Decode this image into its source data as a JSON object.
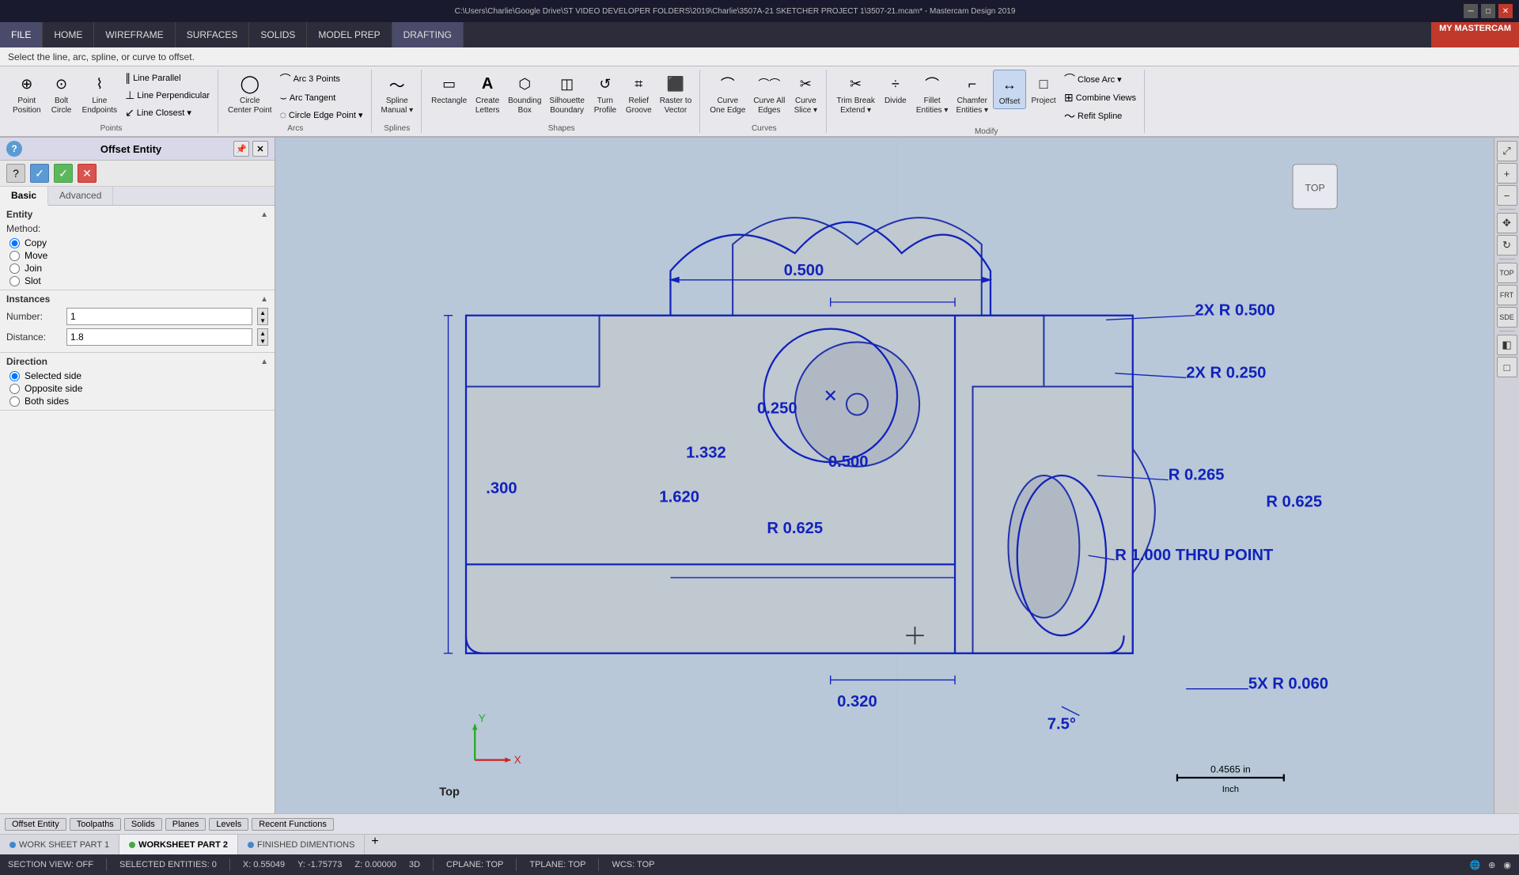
{
  "titlebar": {
    "title": "C:\\Users\\Charlie\\Google Drive\\ST VIDEO DEVELOPER FOLDERS\\2019\\Charlie\\3507A-21 SKETCHER PROJECT 1\\3507-21.mcam* - Mastercam Design 2019",
    "min": "─",
    "max": "□",
    "close": "✕"
  },
  "menu": {
    "items": [
      "FILE",
      "HOME",
      "WIREFRAME",
      "SURFACES",
      "SOLIDS",
      "MODEL PREP",
      "DRAFTING"
    ]
  },
  "prompt": {
    "text": "Select the line, arc, spline, or curve to offset.",
    "my_mastercam": "MY MASTERCAM"
  },
  "ribbon": {
    "points_group": {
      "label": "Points",
      "buttons": [
        {
          "icon": "⊕",
          "label": "Point\nPosition"
        },
        {
          "icon": "⊙",
          "label": "Bolt\nCircle"
        },
        {
          "icon": "⌇",
          "label": "Line\nEndpoints"
        }
      ],
      "small": [
        {
          "icon": "∥",
          "label": "Line Parallel"
        },
        {
          "icon": "⊥",
          "label": "Line Perpendicular"
        },
        {
          "icon": "⊙",
          "label": "Line Closest"
        }
      ]
    },
    "arcs_group": {
      "label": "Arcs",
      "buttons": [
        {
          "icon": "◯",
          "label": "Circle\nCenter Point"
        },
        {
          "icon": "◌",
          "label": "Circle Edge Point"
        }
      ],
      "small": [
        {
          "icon": "⌒",
          "label": "Arc 3 Points"
        },
        {
          "icon": "⌣",
          "label": "Arc Tangent"
        }
      ]
    },
    "splines_group": {
      "label": "Splines",
      "buttons": [
        {
          "icon": "〜",
          "label": "Spline\nManual"
        }
      ]
    },
    "shapes_group": {
      "label": "Shapes",
      "buttons": [
        {
          "icon": "▭",
          "label": "Rectangle"
        },
        {
          "icon": "A",
          "label": "Create\nLetters"
        },
        {
          "icon": "⬡",
          "label": "Bounding\nBox"
        },
        {
          "icon": "◫",
          "label": "Silhouette\nBoundary"
        },
        {
          "icon": "↺",
          "label": "Turn\nProfile"
        },
        {
          "icon": "⌗",
          "label": "Relief\nGroove"
        },
        {
          "icon": "⬛",
          "label": "Raster to\nVector"
        }
      ]
    },
    "curves_group": {
      "label": "Curves",
      "buttons": [
        {
          "icon": "⌒",
          "label": "Curve\nOne Edge"
        },
        {
          "icon": "⌒⌒",
          "label": "Curve All\nEdges"
        },
        {
          "icon": "✂",
          "label": "Curve\nSlice"
        }
      ]
    },
    "modify_group": {
      "label": "Modify",
      "buttons": [
        {
          "icon": "✂",
          "label": "Trim Break\nExtend"
        },
        {
          "icon": "÷",
          "label": "Divide"
        },
        {
          "icon": "⌒",
          "label": "Fillet\nEntities"
        },
        {
          "icon": "⌐",
          "label": "Chamfer\nEntities"
        },
        {
          "icon": "↔",
          "label": "Offset"
        },
        {
          "icon": "□",
          "label": "Project"
        }
      ],
      "small": [
        {
          "icon": "⌒",
          "label": "Close Arc"
        },
        {
          "icon": "⊞",
          "label": "Combine Views"
        },
        {
          "icon": "〜",
          "label": "Refit Spline"
        }
      ]
    }
  },
  "panel": {
    "title": "Offset Entity",
    "help_icon": "?",
    "tabs": [
      "Basic",
      "Advanced"
    ],
    "active_tab": "Basic",
    "entity_section": {
      "label": "Entity",
      "method": {
        "label": "Method:",
        "options": [
          "Copy",
          "Move",
          "Join",
          "Slot"
        ],
        "selected": "Copy"
      }
    },
    "instances_section": {
      "label": "Instances",
      "number_label": "Number:",
      "number_value": "1",
      "distance_label": "Distance:",
      "distance_value": "1.8"
    },
    "direction_section": {
      "label": "Direction",
      "options": [
        "Selected side",
        "Opposite side",
        "Both sides"
      ],
      "selected": "Selected side"
    },
    "actions": {
      "cancel": "✕",
      "ok_green": "✓",
      "ok_blue": "✓"
    }
  },
  "canvas": {
    "view_label": "Top",
    "scale": "0.4565 in",
    "scale_unit": "Inch",
    "dimensions": {
      "d1": "0.500",
      "d2": "0.250",
      "d3": "0.500",
      "d4": "1.332",
      "d5": "1.620",
      "d6": "0.300",
      "d7": "R 0.625",
      "d8": "2X R 0.500",
      "d9": "2X R 0.250",
      "d10": "R 0.265",
      "d11": "R 1.000 THRU POINT",
      "d12": "R 0.625",
      "d13": "5X R 0.060",
      "d14": "7.5°",
      "d15": "0.320"
    }
  },
  "bottom_tabs": [
    {
      "label": "Offset Entity",
      "active": false,
      "color": "#888"
    },
    {
      "label": "Toolpaths",
      "active": false,
      "color": "#888"
    },
    {
      "label": "Solids",
      "active": false,
      "color": "#888"
    },
    {
      "label": "Planes",
      "active": false,
      "color": "#888"
    },
    {
      "label": "Levels",
      "active": false,
      "color": "#888"
    },
    {
      "label": "Recent Functions",
      "active": false,
      "color": "#888"
    }
  ],
  "worksheet_tabs": [
    {
      "label": "WORK SHEET PART 1",
      "active": false,
      "color": "#4488cc"
    },
    {
      "label": "WORKSHEET PART 2",
      "active": true,
      "color": "#44aa44"
    },
    {
      "label": "FINISHED DIMENTIONS",
      "active": false,
      "color": "#4488cc"
    }
  ],
  "status_bar": {
    "section_view": "SECTION VIEW: OFF",
    "selected": "SELECTED ENTITIES: 0",
    "x": "X: 0.55049",
    "y": "Y: -1.75773",
    "z": "Z: 0.00000",
    "mode": "3D",
    "cplane": "CPLANE: TOP",
    "tplane": "TPLANE: TOP",
    "wcs": "WCS: TOP"
  }
}
